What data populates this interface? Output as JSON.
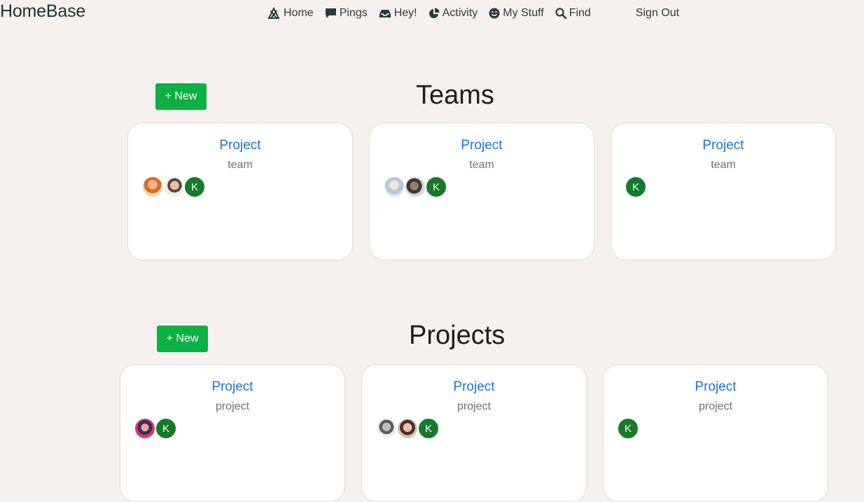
{
  "brand": "HomeBase",
  "nav": {
    "home": "Home",
    "pings": "Pings",
    "hey": "Hey!",
    "activity": "Activity",
    "mystuff": "My Stuff",
    "find": "Find",
    "signout": "Sign Out"
  },
  "teams": {
    "title": "Teams",
    "new_label": "+ New",
    "cards": [
      {
        "title": "Project",
        "subtitle": "team",
        "avatars": [
          "photo",
          "photo",
          "K"
        ]
      },
      {
        "title": "Project",
        "subtitle": "team",
        "avatars": [
          "photo",
          "photo",
          "K"
        ]
      },
      {
        "title": "Project",
        "subtitle": "team",
        "avatars": [
          "K"
        ]
      }
    ]
  },
  "projects": {
    "title": "Projects",
    "new_label": "+ New",
    "cards": [
      {
        "title": "Project",
        "subtitle": "project",
        "avatars": [
          "photo",
          "K"
        ]
      },
      {
        "title": "Project",
        "subtitle": "project",
        "avatars": [
          "photo",
          "photo",
          "K"
        ]
      },
      {
        "title": "Project",
        "subtitle": "project",
        "avatars": [
          "K"
        ]
      }
    ]
  },
  "colors": {
    "background": "#f6f1ee",
    "new_button": "#0db044",
    "card_title": "#1a72e6",
    "avatar_initial_bg": "#157a2a"
  }
}
